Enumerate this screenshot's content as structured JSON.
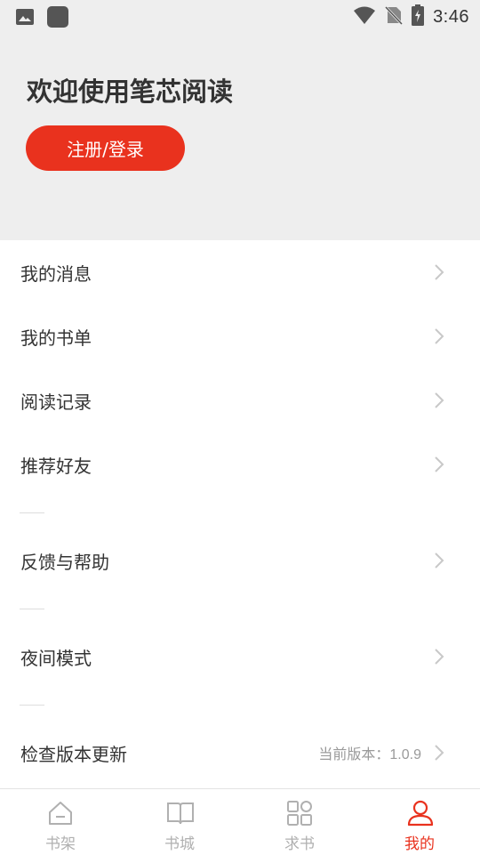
{
  "status_bar": {
    "time": "3:46",
    "icons": [
      "image-icon",
      "app-square-icon",
      "wifi-icon",
      "no-sim-icon",
      "battery-charging-icon"
    ]
  },
  "header": {
    "welcome_text": "欢迎使用笔芯阅读",
    "login_button": "注册/登录"
  },
  "menu": {
    "items": [
      {
        "label": "我的消息",
        "value": ""
      },
      {
        "label": "我的书单",
        "value": ""
      },
      {
        "label": "阅读记录",
        "value": ""
      },
      {
        "label": "推荐好友",
        "value": ""
      },
      {
        "label": "反馈与帮助",
        "value": ""
      },
      {
        "label": "夜间模式",
        "value": ""
      },
      {
        "label": "检查版本更新",
        "value": "当前版本：1.0.9"
      }
    ]
  },
  "bottom_nav": {
    "items": [
      {
        "label": "书架",
        "icon": "home-icon",
        "active": false
      },
      {
        "label": "书城",
        "icon": "book-icon",
        "active": false
      },
      {
        "label": "求书",
        "icon": "grid-icon",
        "active": false
      },
      {
        "label": "我的",
        "icon": "user-icon",
        "active": true
      }
    ]
  },
  "colors": {
    "accent": "#e9321e",
    "header_bg": "#eeeeee",
    "text": "#333333",
    "muted": "#9a9a9a",
    "nav_inactive": "#b0b0b0"
  }
}
